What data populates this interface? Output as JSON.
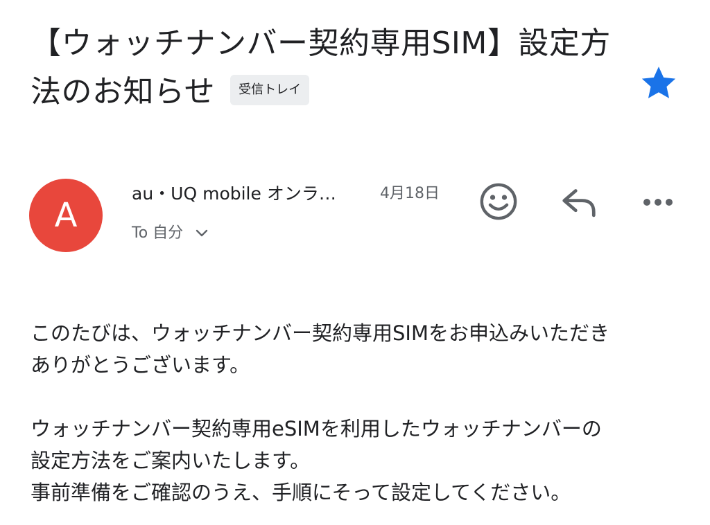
{
  "email": {
    "subject": "【ウォッチナンバー契約専用SIM】設定方法のお知らせ",
    "label_badge": "受信トレイ",
    "starred": true,
    "sender": {
      "avatar_letter": "A",
      "name": "au・UQ mobile オンラ…",
      "date": "4月18日",
      "recipient": "To 自分"
    },
    "actions": {
      "emoji_icon": "smiley-icon",
      "reply_icon": "reply-icon",
      "more_icon": "more-horizontal-icon"
    },
    "body": {
      "para1_line1": "このたびは、ウォッチナンバー契約専用SIMをお申込みいただき",
      "para1_line2": "ありがとうございます。",
      "para2_line1": "ウォッチナンバー契約専用eSIMを利用したウォッチナンバーの",
      "para2_line2": "設定方法をご案内いたします。",
      "para2_line3": "事前準備をご確認のうえ、手順にそって設定してください。"
    }
  },
  "colors": {
    "star": "#1a73e8",
    "avatar_bg": "#e8473c",
    "icon_gray": "#5f6368",
    "badge_bg": "#eceef0"
  }
}
